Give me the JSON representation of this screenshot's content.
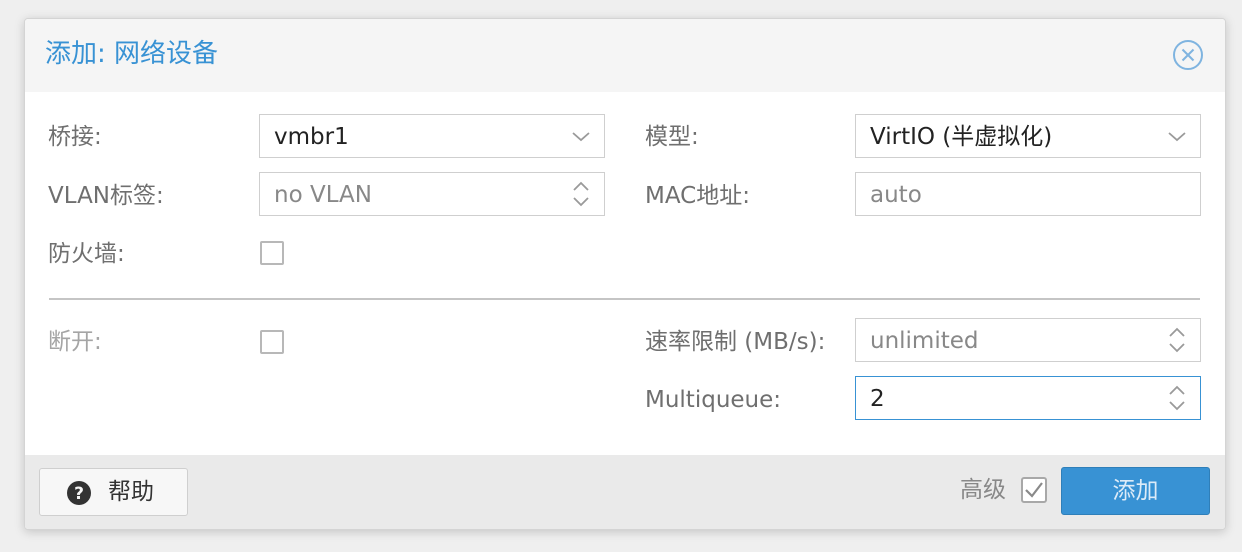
{
  "dialog": {
    "title": "添加: 网络设备"
  },
  "fields": {
    "bridge": {
      "label": "桥接:",
      "value": "vmbr1"
    },
    "model": {
      "label": "模型:",
      "value": "VirtIO (半虚拟化)"
    },
    "vlan": {
      "label": "VLAN标签:",
      "placeholder": "no VLAN"
    },
    "mac": {
      "label": "MAC地址:",
      "placeholder": "auto"
    },
    "firewall": {
      "label": "防火墙:",
      "checked": false
    },
    "disconnect": {
      "label": "断开:",
      "checked": false
    },
    "rate_limit": {
      "label": "速率限制 (MB/s):",
      "placeholder": "unlimited"
    },
    "multiqueue": {
      "label": "Multiqueue:",
      "value": "2"
    }
  },
  "footer": {
    "help_label": "帮助",
    "advanced_label": "高级",
    "advanced_checked": true,
    "add_label": "添加"
  },
  "icons": {
    "close": "close-circle-icon",
    "dropdown": "chevron-down-icon",
    "spinner": "spinner-arrows-icon",
    "help": "question-circle-icon",
    "check": "checkmark-icon"
  },
  "colors": {
    "accent": "#3892d4",
    "title": "#3892d4",
    "label": "#6f6f6f",
    "disabled_label": "#a5a5a5"
  }
}
